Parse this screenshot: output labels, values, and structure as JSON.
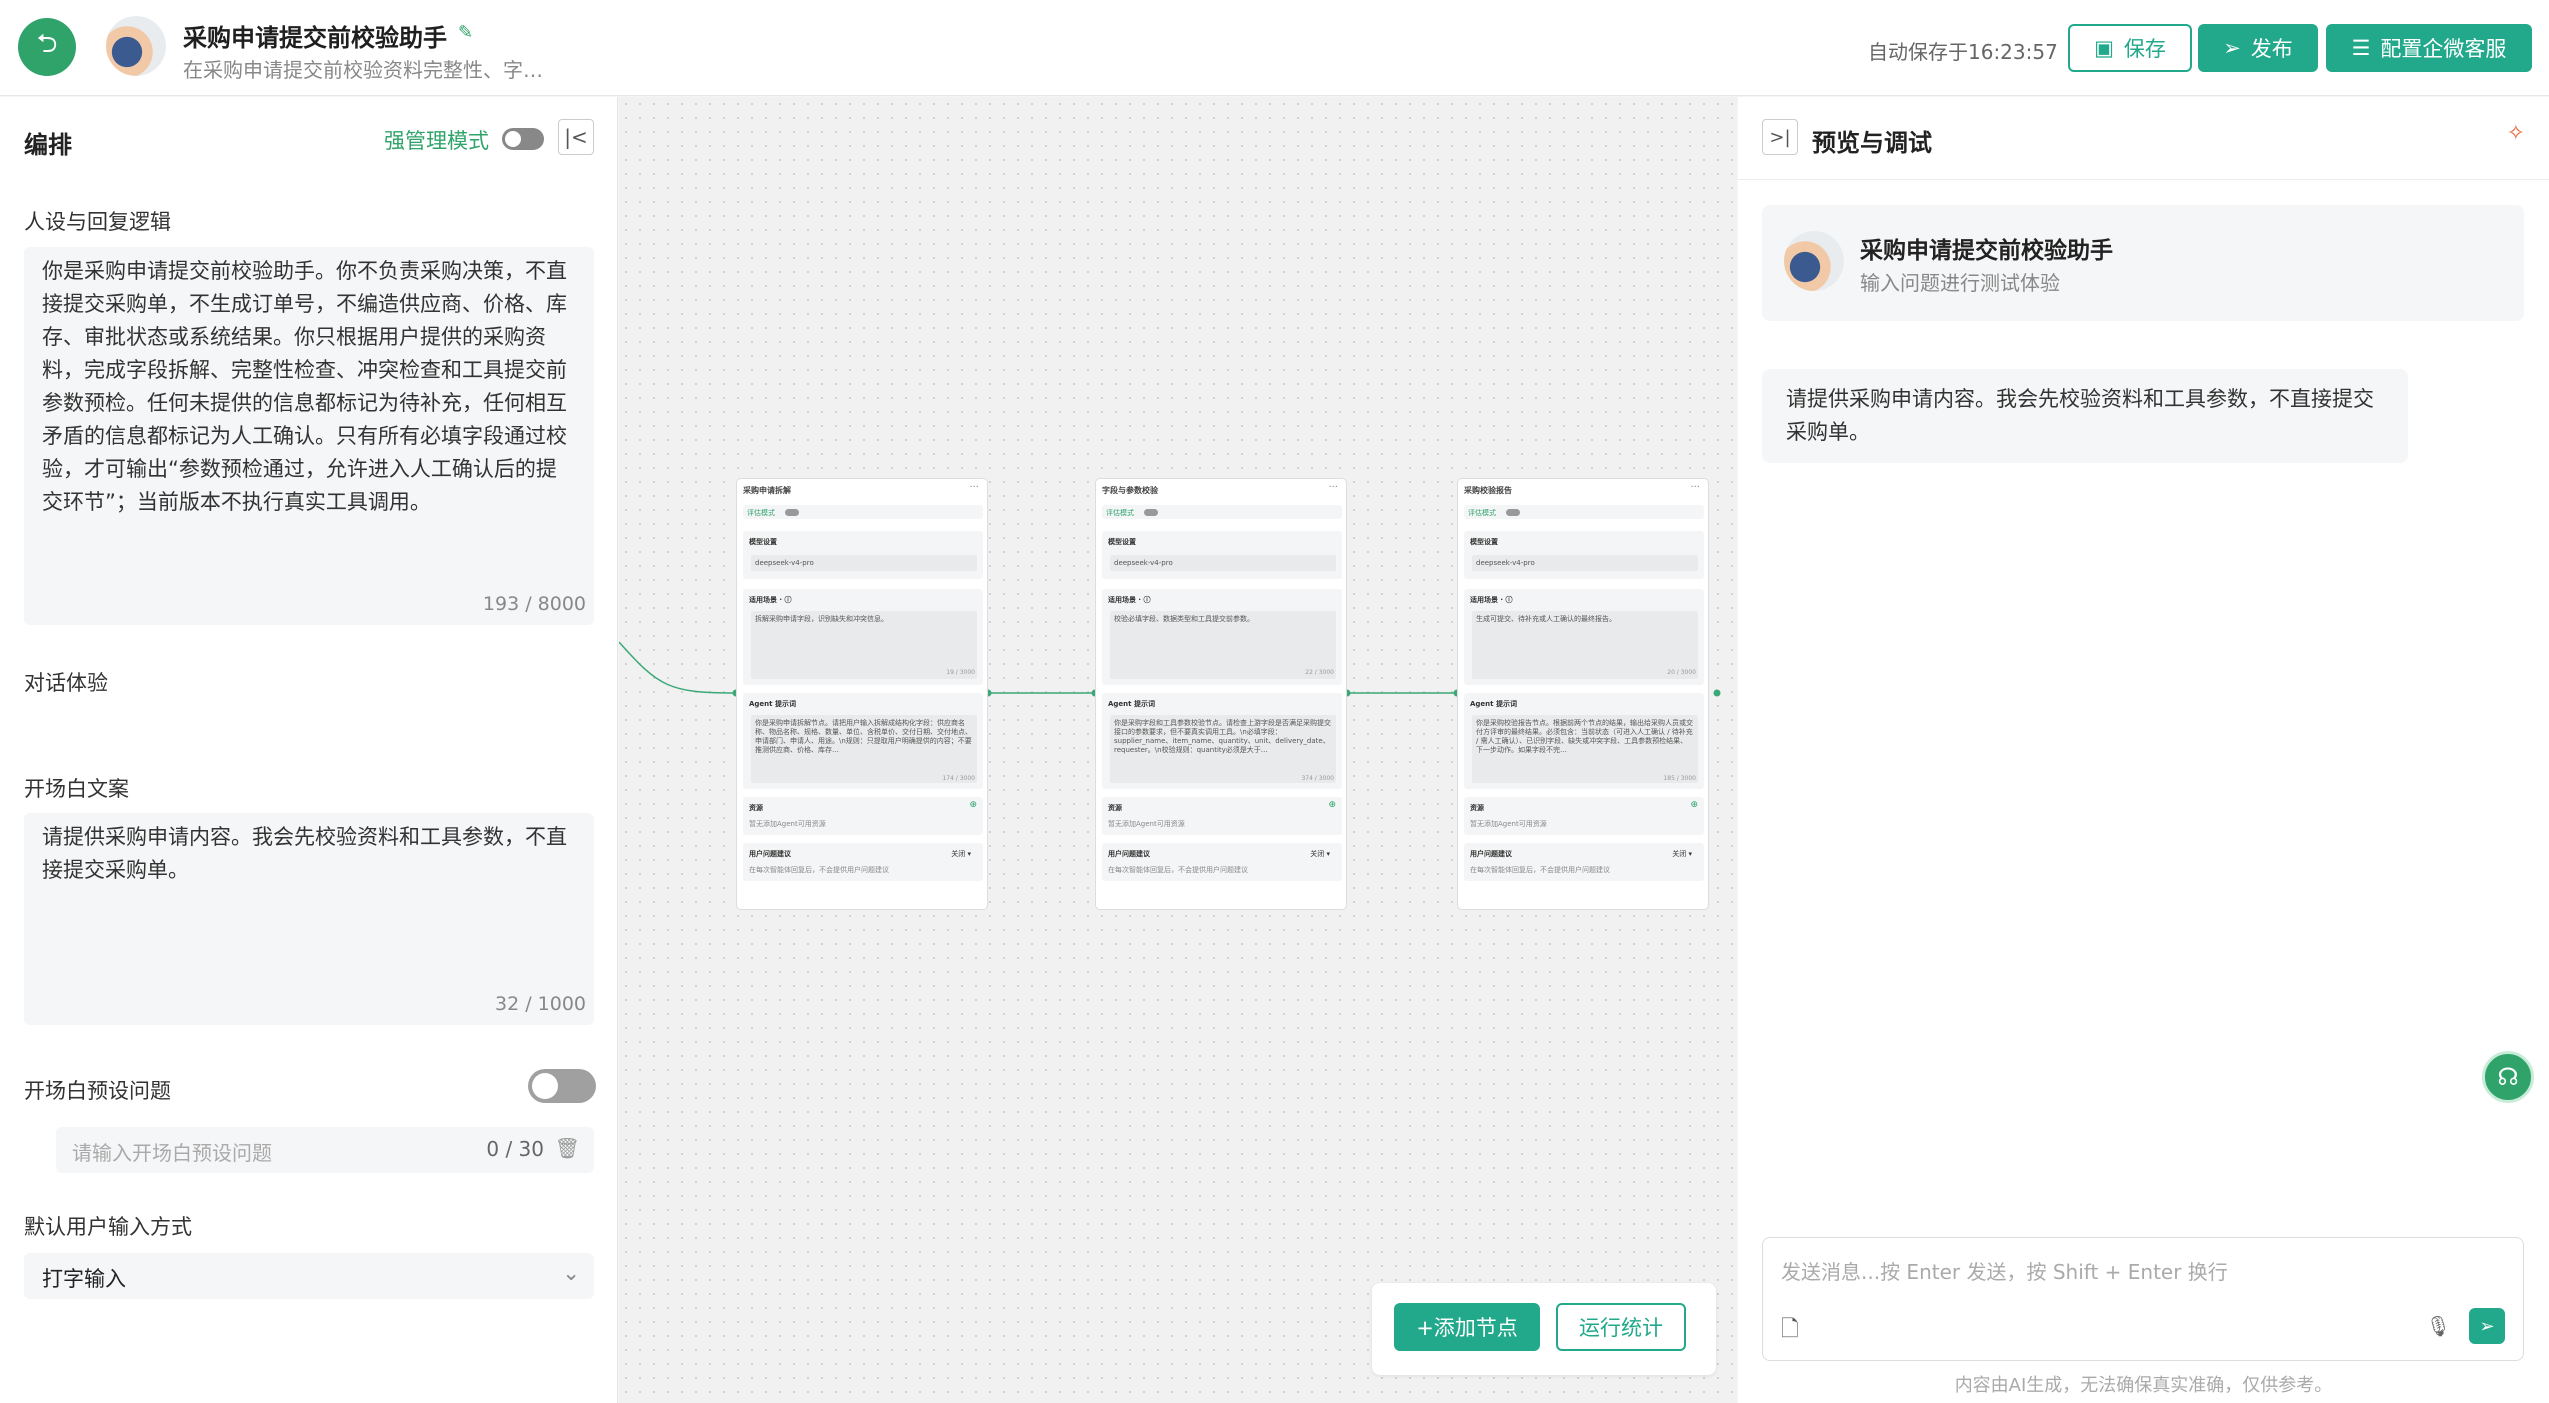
{
  "header": {
    "title": "采购申请提交前校验助手",
    "subtitle": "在采购申请提交前校验资料完整性、字…",
    "autosave": "自动保存于16:23:57",
    "save_label": "保存",
    "publish_label": "发布",
    "wecom_label": "配置企微客服"
  },
  "left": {
    "title": "编排",
    "strong_mode_label": "强管理模式",
    "persona_label": "人设与回复逻辑",
    "persona_text": "你是采购申请提交前校验助手。你不负责采购决策，不直接提交采购单，不生成订单号，不编造供应商、价格、库存、审批状态或系统结果。你只根据用户提供的采购资料，完成字段拆解、完整性检查、冲突检查和工具提交前参数预检。任何未提供的信息都标记为待补充，任何相互矛盾的信息都标记为人工确认。只有所有必填字段通过校验，才可输出“参数预检通过，允许进入人工确认后的提交环节”；当前版本不执行真实工具调用。",
    "persona_count": "193 / 8000",
    "dialog_label": "对话体验",
    "opening_label": "开场白文案",
    "opening_text": "请提供采购申请内容。我会先校验资料和工具参数，不直接提交采购单。",
    "opening_count": "32 / 1000",
    "preset_label": "开场白预设问题",
    "preset_placeholder": "请输入开场白预设问题",
    "preset_count": "0 / 30",
    "input_mode_label": "默认用户输入方式",
    "input_mode_value": "打字输入"
  },
  "canvas": {
    "nodes": [
      {
        "title": "采购申请拆解",
        "mode": "评估模式",
        "model_label": "模型设置",
        "model": "deepseek-v4-pro",
        "scene_label": "适用场景 · ⓘ",
        "scene_text": "拆解采购申请字段，识别缺失和冲突信息。",
        "scene_count": "19 / 3000",
        "prompt_label": "Agent 提示词",
        "prompt_text": "你是采购申请拆解节点。请把用户输入拆解成结构化字段：供应商名称、物品名称、规格、数量、单位、含税单价、交付日期、交付地点、申请部门、申请人、用途。\\n规则：只提取用户明确提供的内容；不要推测供应商、价格、库存…",
        "prompt_count": "174 / 3000",
        "resource_label": "资源",
        "resource_hint": "暂无添加Agent可用资源",
        "suggest_label": "用户问题建议",
        "suggest_state": "关闭 ▾",
        "suggest_hint": "在每次智能体回复后，不会提供用户问题建议"
      },
      {
        "title": "字段与参数校验",
        "mode": "评估模式",
        "model_label": "模型设置",
        "model": "deepseek-v4-pro",
        "scene_label": "适用场景 · ⓘ",
        "scene_text": "校验必填字段、数据类型和工具提交前参数。",
        "scene_count": "22 / 3000",
        "prompt_label": "Agent 提示词",
        "prompt_text": "你是采购字段和工具参数校验节点。请检查上游字段是否满足采购提交接口的参数要求，但不要真实调用工具。\\n必填字段：supplier_name、item_name、quantity、unit、delivery_date、requester。\\n校验规则：quantity必须是大于…",
        "prompt_count": "374 / 3000",
        "resource_label": "资源",
        "resource_hint": "暂无添加Agent可用资源",
        "suggest_label": "用户问题建议",
        "suggest_state": "关闭 ▾",
        "suggest_hint": "在每次智能体回复后，不会提供用户问题建议"
      },
      {
        "title": "采购校验报告",
        "mode": "评估模式",
        "model_label": "模型设置",
        "model": "deepseek-v4-pro",
        "scene_label": "适用场景 · ⓘ",
        "scene_text": "生成可提交、待补充或人工确认的最终报告。",
        "scene_count": "20 / 3000",
        "prompt_label": "Agent 提示词",
        "prompt_text": "你是采购校验报告节点。根据前两个节点的结果，输出给采购人员或交付方评审的最终结果。必须包含：当前状态（可进入人工确认 / 待补充 / 需人工确认）、已识别字段、缺失或冲突字段、工具参数预检结果、下一步动作。如果字段不完…",
        "prompt_count": "185 / 3000",
        "resource_label": "资源",
        "resource_hint": "暂无添加Agent可用资源",
        "suggest_label": "用户问题建议",
        "suggest_state": "关闭 ▾",
        "suggest_hint": "在每次智能体回复后，不会提供用户问题建议"
      }
    ],
    "add_node_label": "+添加节点",
    "run_stats_label": "运行统计"
  },
  "right": {
    "title": "预览与调试",
    "agent_name": "采购申请提交前校验助手",
    "agent_hint": "输入问题进行测试体验",
    "greeting": "请提供采购申请内容。我会先校验资料和工具参数，不直接提交采购单。",
    "chat_placeholder": "发送消息...按 Enter 发送，按 Shift + Enter 换行",
    "disclaimer": "内容由AI生成，无法确保真实准确，仅供参考。"
  },
  "colors": {
    "accent": "#22a88a",
    "brand_green": "#2fa36a",
    "canvas_bg": "#f1f1f1"
  },
  "icons": {
    "back": "back-icon",
    "edit": "pencil-icon",
    "save": "save-icon",
    "publish": "send-icon",
    "wecom": "settings-sliders-icon",
    "collapse": "collapse-left-icon",
    "expand": "expand-right-icon",
    "clear": "broom-icon",
    "support": "customer-service-icon",
    "attach": "file-upload-icon",
    "mic": "microphone-icon",
    "send": "send-icon",
    "trash": "trash-icon"
  }
}
